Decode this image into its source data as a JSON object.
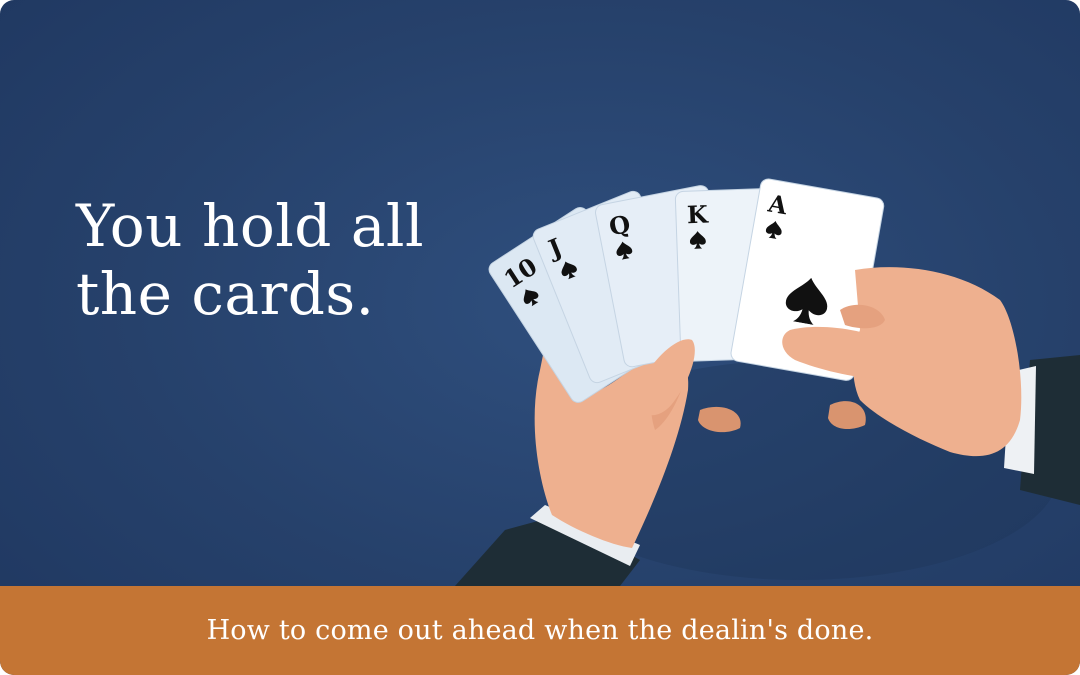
{
  "headline": {
    "line1": "You hold all",
    "line2": "the cards."
  },
  "footer": {
    "text": "How to come out ahead when the dealin's done."
  },
  "cards": [
    {
      "rank": "10",
      "suit": "spade-icon"
    },
    {
      "rank": "J",
      "suit": "spade-icon"
    },
    {
      "rank": "Q",
      "suit": "spade-icon"
    },
    {
      "rank": "K",
      "suit": "spade-icon"
    },
    {
      "rank": "A",
      "suit": "spade-icon"
    }
  ],
  "colors": {
    "background": "#26416b",
    "footer": "#c47534",
    "text": "#ffffff",
    "skin": "#eeb08f",
    "sleeve": "#1e2d36"
  }
}
